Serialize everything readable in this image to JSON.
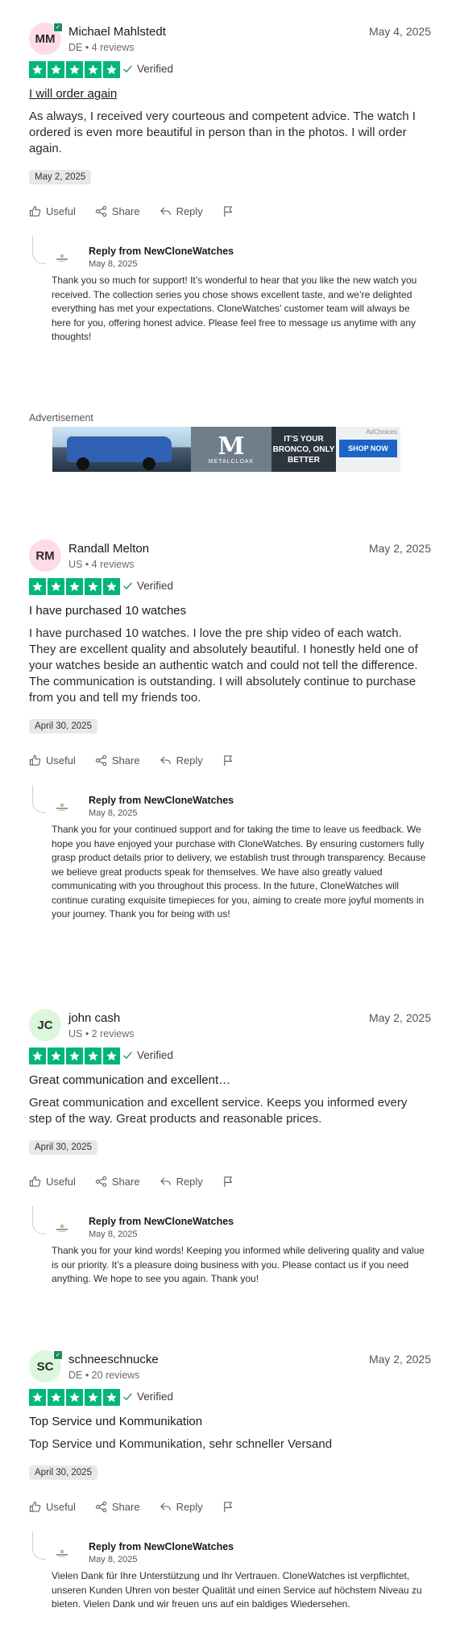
{
  "common": {
    "verified": "Verified",
    "useful": "Useful",
    "share": "Share",
    "reply": "Reply",
    "reply_from": "Reply from NewCloneWatches"
  },
  "colors": {
    "star_green": "#00b67a",
    "verified_badge": "#1d8a5c"
  },
  "advertisement": {
    "label": "Advertisement",
    "logo_text": "METALCLOAK",
    "headline": "IT'S YOUR BRONCO, ONLY BETTER",
    "adchoices": "AdChoices",
    "cta": "SHOP NOW"
  },
  "reviews": [
    {
      "initials": "MM",
      "avatar_color": "#ffdbe7",
      "verified_badge": true,
      "name": "Michael Mahlstedt",
      "meta": "DE • 4 reviews",
      "date": "May 4, 2025",
      "rating": 5,
      "title": "I will order again",
      "body": "As always, I received very courteous and competent advice. The watch I ordered is even more beautiful in person than in the photos. I will order again.",
      "experience_date": "May 2, 2025",
      "reply_date": "May 8, 2025",
      "reply_text": "Thank you so much for support! It’s wonderful to hear that you like the new watch you received. The collection series you chose shows excellent taste, and we’re delighted everything has met your expectations. CloneWatches’ customer team will always be here for you, offering honest advice. Please feel free to message us anytime with any thoughts!"
    },
    {
      "initials": "RM",
      "avatar_color": "#ffdbe7",
      "verified_badge": false,
      "name": "Randall Melton",
      "meta": "US • 4 reviews",
      "date": "May 2, 2025",
      "rating": 5,
      "title": "I have purchased 10 watches",
      "body": "I have purchased 10 watches. I love the pre ship video of each watch. They are excellent quality and absolutely beautiful. I honestly held one of your watches beside an authentic watch and could not tell the difference. The communication is outstanding. I will absolutely continue to purchase from you and tell my friends too.",
      "experience_date": "April 30, 2025",
      "reply_date": "May 8, 2025",
      "reply_text": "Thank you for your continued support and for taking the time to leave us feedback. We hope you have enjoyed your purchase with CloneWatches. By ensuring customers fully grasp product details prior to delivery, we establish trust through transparency. Because we believe great products speak for themselves. We have also greatly valued communicating with you throughout this process. In the future, CloneWatches will continue curating exquisite timepieces for you, aiming to create more joyful moments in your journey. Thank you for being with us!"
    },
    {
      "initials": "JC",
      "avatar_color": "#dcf7dc",
      "verified_badge": false,
      "name": "john cash",
      "meta": "US • 2 reviews",
      "date": "May 2, 2025",
      "rating": 5,
      "title": "Great communication and excellent…",
      "body": "Great communication and excellent service. Keeps you informed every step of the way. Great products and reasonable prices.",
      "experience_date": "April 30, 2025",
      "reply_date": "May 8, 2025",
      "reply_text": "Thank you for your kind words! Keeping you informed while delivering quality and value is our priority. It’s a pleasure doing business with you. Please contact us if you need anything. We hope to see you again. Thank you!"
    },
    {
      "initials": "SC",
      "avatar_color": "#dcf7dc",
      "verified_badge": true,
      "name": "schneeschnucke",
      "meta": "DE • 20 reviews",
      "date": "May 2, 2025",
      "rating": 5,
      "title": "Top Service und Kommunikation",
      "body": "Top Service und Kommunikation, sehr schneller Versand",
      "experience_date": "April 30, 2025",
      "reply_date": "May 8, 2025",
      "reply_text": "Vielen Dank für Ihre Unterstützung und Ihr Vertrauen. CloneWatches ist verpflichtet, unseren Kunden Uhren von bester Qualität und einen Service auf höchstem Niveau zu bieten. Vielen Dank und wir freuen uns auf ein baldiges Wiedersehen."
    }
  ]
}
